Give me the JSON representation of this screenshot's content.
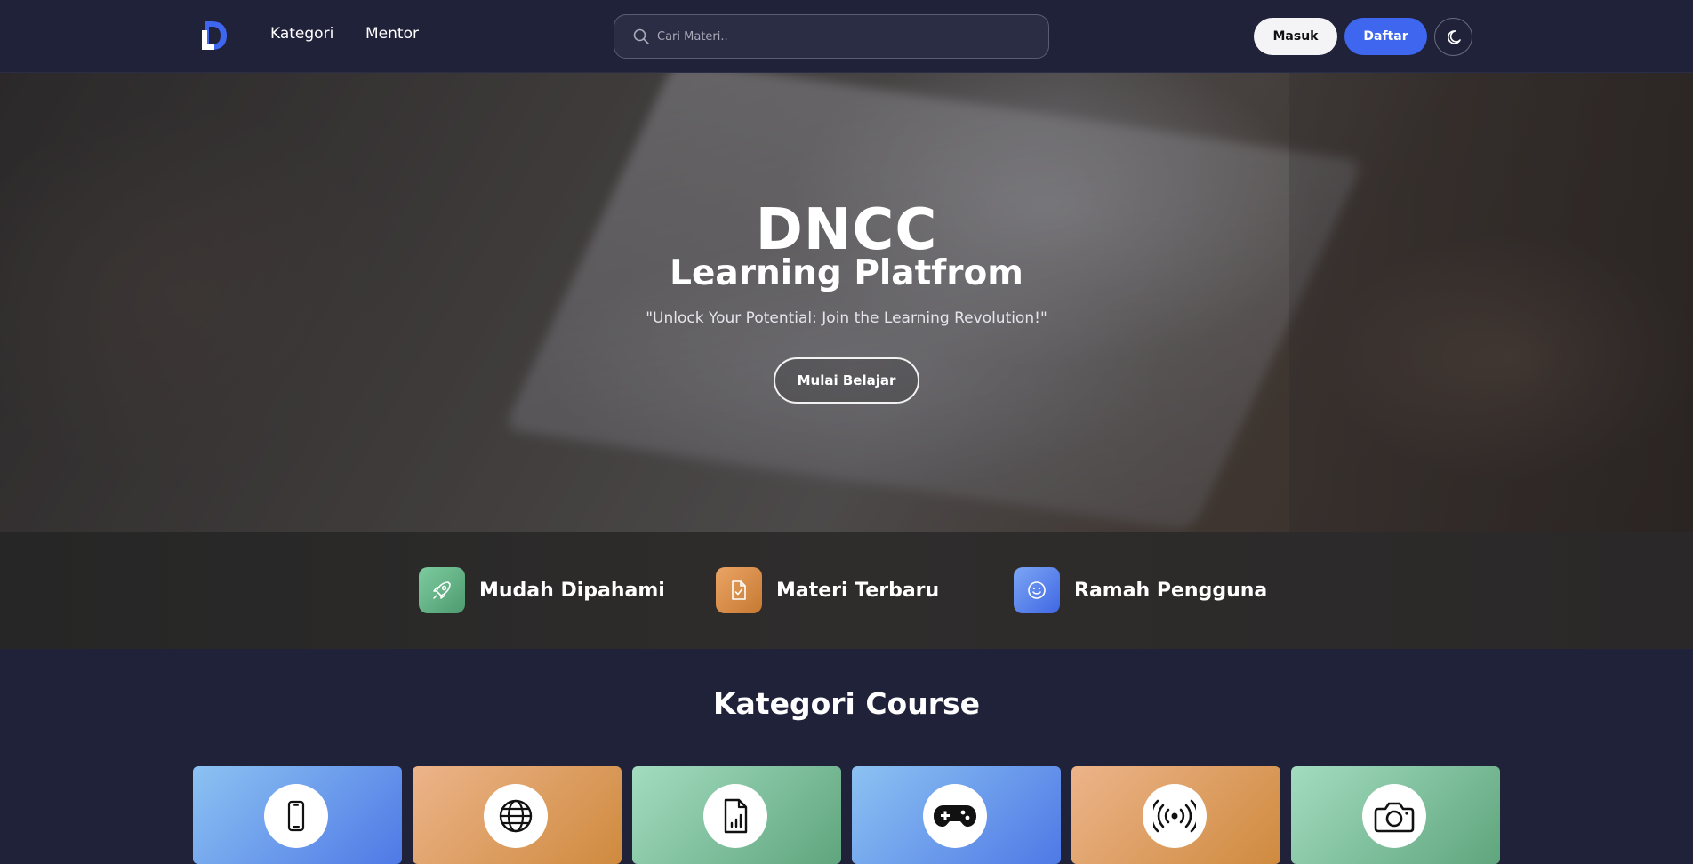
{
  "nav": {
    "links": [
      "Kategori",
      "Mentor"
    ],
    "search_placeholder": "Cari Materi..",
    "login_label": "Masuk",
    "register_label": "Daftar",
    "theme_icon": "moon-icon"
  },
  "hero": {
    "title": "DNCC",
    "subtitle": "Learning Platfrom",
    "tagline": "\"Unlock Your Potential: Join the Learning Revolution!\"",
    "cta_label": "Mulai Belajar"
  },
  "features": [
    {
      "label": "Mudah Dipahami",
      "icon": "rocket-icon",
      "color": "#5fa57d"
    },
    {
      "label": "Materi Terbaru",
      "icon": "document-check-icon",
      "color": "#cf8a3e"
    },
    {
      "label": "Ramah Pengguna",
      "icon": "smiley-icon",
      "color": "#4f79e6"
    }
  ],
  "categories": {
    "title": "Kategori Course",
    "items": [
      {
        "icon": "smartphone-icon",
        "color": "blue"
      },
      {
        "icon": "globe-icon",
        "color": "orange"
      },
      {
        "icon": "document-chart-icon",
        "color": "green"
      },
      {
        "icon": "gamepad-icon",
        "color": "blue"
      },
      {
        "icon": "broadcast-icon",
        "color": "orange"
      },
      {
        "icon": "camera-icon",
        "color": "green"
      }
    ]
  },
  "colors": {
    "nav_bg": "#20223a",
    "accent": "#3f66ee"
  }
}
